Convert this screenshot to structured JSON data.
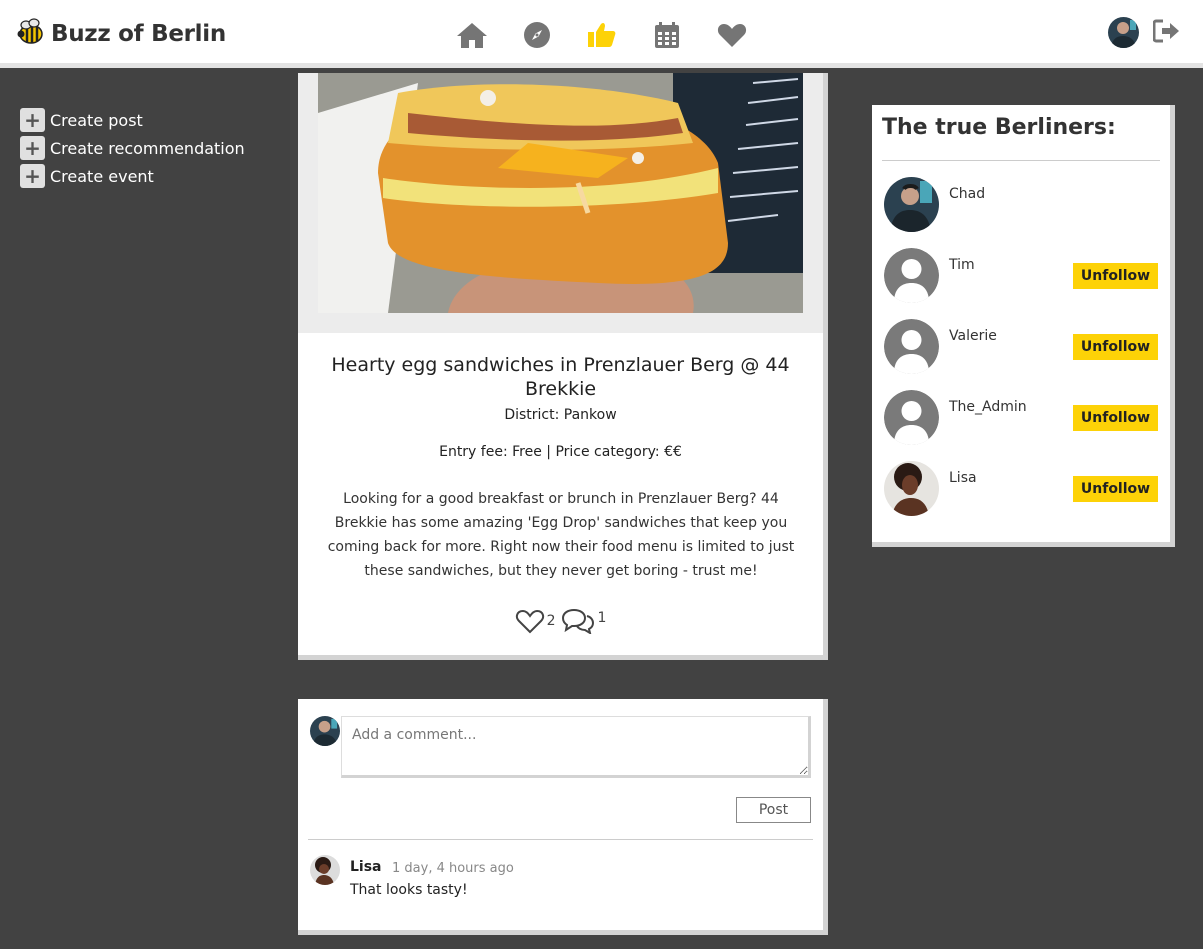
{
  "brand": {
    "name": "Buzz of Berlin",
    "logo_icon": "bee-icon"
  },
  "nav": {
    "items": [
      {
        "icon": "home-icon",
        "color": "#757575"
      },
      {
        "icon": "compass-icon",
        "color": "#757575"
      },
      {
        "icon": "thumbs-up-icon",
        "color": "#fdd207"
      },
      {
        "icon": "calendar-icon",
        "color": "#757575"
      },
      {
        "icon": "heart-icon",
        "color": "#757575"
      }
    ],
    "logout_icon": "sign-out-icon"
  },
  "sidebar": {
    "items": [
      {
        "label": "Create post"
      },
      {
        "label": "Create recommendation"
      },
      {
        "label": "Create event"
      }
    ]
  },
  "post": {
    "title": "Hearty egg sandwiches in Prenzlauer Berg @ 44 Brekkie",
    "district": "District: Pankow",
    "fee_line": "Entry fee: Free | Price category: €€",
    "description": "Looking for a good breakfast or brunch in Prenzlauer Berg? 44 Brekkie has some amazing 'Egg Drop' sandwiches that keep you coming back for more. Right now their food menu is limited to just these sandwiches, but they never get boring - trust me!",
    "likes": "2",
    "comments_count": "1"
  },
  "comment_form": {
    "placeholder": "Add a comment...",
    "submit_label": "Post"
  },
  "comments": [
    {
      "author": "Lisa",
      "time": "1 day, 4 hours ago",
      "text": "That looks tasty!"
    }
  ],
  "berliners": {
    "title": "The true Berliners:",
    "unfollow_label": "Unfollow",
    "users": [
      {
        "name": "Chad"
      },
      {
        "name": "Tim"
      },
      {
        "name": "Valerie"
      },
      {
        "name": "The_Admin"
      },
      {
        "name": "Lisa"
      }
    ]
  },
  "colors": {
    "accent": "#fdd207",
    "background": "#424242",
    "icon_grey": "#757575"
  }
}
